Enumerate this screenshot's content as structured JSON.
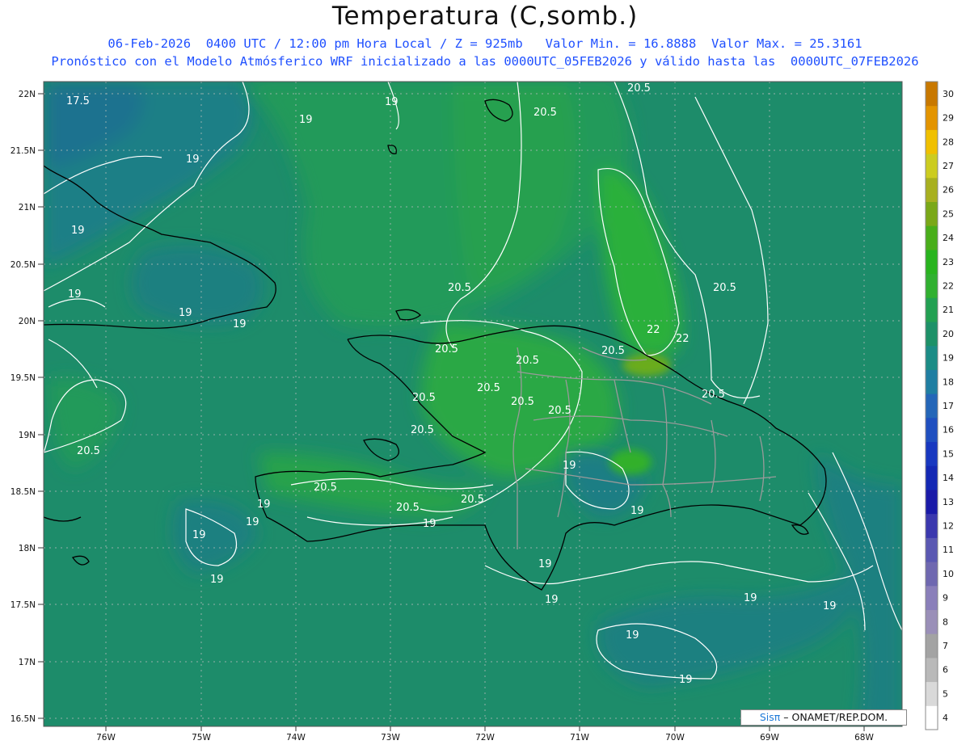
{
  "title": "Temperatura (C,somb.)",
  "subtitle1": "06-Feb-2026  0400 UTC / 12:00 pm Hora Local / Z = 925mb   Valor Min. = 16.8888  Valor Max. = 25.3161",
  "subtitle2": "Pronóstico con el Modelo Atmósferico WRF inicializado a las 0000UTC_05FEB2026 y válido hasta las  0000UTC_07FEB2026",
  "credit": {
    "brand": "Sisπ",
    "text": "– ONAMET/REP.DOM."
  },
  "lat_labels": [
    "22N",
    "21.5N",
    "21N",
    "20.5N",
    "20N",
    "19.5N",
    "19N",
    "18.5N",
    "18N",
    "17.5N",
    "17N",
    "16.5N"
  ],
  "lon_labels": [
    "76W",
    "75W",
    "74W",
    "73W",
    "72W",
    "71W",
    "70W",
    "69W",
    "68W"
  ],
  "colorbar": {
    "levels": [
      "4",
      "5",
      "6",
      "7",
      "8",
      "9",
      "10",
      "11",
      "12",
      "13",
      "14",
      "15",
      "16",
      "17",
      "18",
      "19",
      "20",
      "21",
      "22",
      "23",
      "24",
      "25",
      "26",
      "27",
      "28",
      "29",
      "30"
    ],
    "colors": [
      "#ffffff",
      "#d9d9d9",
      "#b9b9b9",
      "#a3a3a3",
      "#9a8fb8",
      "#8a7fba",
      "#6f68b0",
      "#5a58b2",
      "#3b38ae",
      "#1a1aa8",
      "#1428b4",
      "#1838c0",
      "#1f4fc0",
      "#2466b8",
      "#1f7ea2",
      "#1b8c86",
      "#1d9168",
      "#22a052",
      "#30b030",
      "#28b41e",
      "#49ae1a",
      "#7aa818",
      "#a8b020",
      "#cccc20",
      "#f0c000",
      "#e39400",
      "#c87800"
    ]
  },
  "contour_labels": [
    "17.5",
    "19",
    "19",
    "19",
    "19",
    "19",
    "19",
    "19",
    "19",
    "19",
    "19",
    "19",
    "19",
    "19",
    "19",
    "19",
    "19",
    "19",
    "19",
    "19",
    "19",
    "20.5",
    "20.5",
    "20.5",
    "20.5",
    "20.5",
    "20.5",
    "20.5",
    "20.5",
    "20.5",
    "20.5",
    "20.5",
    "20.5",
    "20.5",
    "20.5",
    "20.5",
    "20.5",
    "20.5",
    "22",
    "22"
  ]
}
